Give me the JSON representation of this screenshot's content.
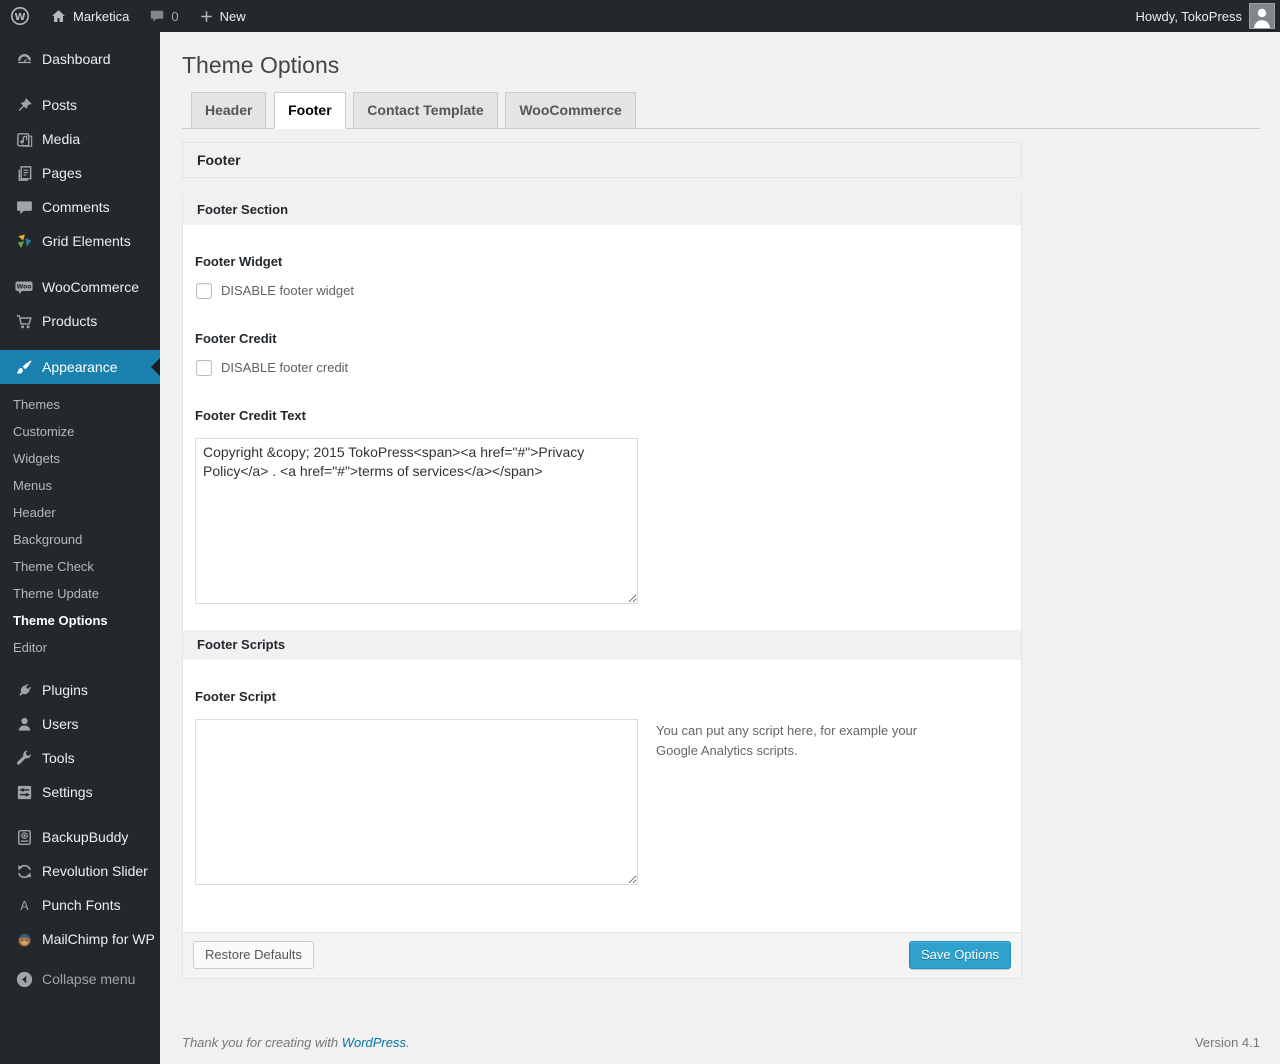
{
  "admin_bar": {
    "site_name": "Marketica",
    "comment_count": "0",
    "new_label": "New",
    "howdy": "Howdy, TokoPress"
  },
  "sidebar": {
    "items": [
      {
        "label": "Dashboard"
      },
      {
        "label": "Posts"
      },
      {
        "label": "Media"
      },
      {
        "label": "Pages"
      },
      {
        "label": "Comments"
      },
      {
        "label": "Grid Elements"
      },
      {
        "label": "WooCommerce"
      },
      {
        "label": "Products"
      },
      {
        "label": "Appearance"
      },
      {
        "label": "Plugins"
      },
      {
        "label": "Users"
      },
      {
        "label": "Tools"
      },
      {
        "label": "Settings"
      },
      {
        "label": "BackupBuddy"
      },
      {
        "label": "Revolution Slider"
      },
      {
        "label": "Punch Fonts"
      },
      {
        "label": "MailChimp for WP"
      },
      {
        "label": "Collapse menu"
      }
    ],
    "appearance_submenu": [
      "Themes",
      "Customize",
      "Widgets",
      "Menus",
      "Header",
      "Background",
      "Theme Check",
      "Theme Update",
      "Theme Options",
      "Editor"
    ],
    "current_item": "Appearance",
    "current_submenu_item": "Theme Options"
  },
  "page": {
    "title": "Theme Options"
  },
  "tabs": [
    {
      "label": "Header",
      "active": false
    },
    {
      "label": "Footer",
      "active": true
    },
    {
      "label": "Contact Template",
      "active": false
    },
    {
      "label": "WooCommerce",
      "active": false
    }
  ],
  "panel": {
    "heading": "Footer",
    "sections": [
      {
        "title": "Footer Section"
      },
      {
        "title": "Footer Scripts"
      }
    ],
    "fields": {
      "footer_widget": {
        "label": "Footer Widget",
        "checkbox_label": "DISABLE footer widget",
        "checked": false
      },
      "footer_credit": {
        "label": "Footer Credit",
        "checkbox_label": "DISABLE footer credit",
        "checked": false
      },
      "footer_credit_text": {
        "label": "Footer Credit Text",
        "value": "Copyright &copy; 2015 TokoPress<span><a href=\"#\">Privacy Policy</a> . <a href=\"#\">terms of services</a></span>"
      },
      "footer_script": {
        "label": "Footer Script",
        "value": "",
        "description": "You can put any script here, for example your Google Analytics scripts."
      }
    },
    "actions": {
      "restore": "Restore Defaults",
      "save": "Save Options"
    }
  },
  "footer": {
    "thanks_prefix": "Thank you for creating with",
    "wordpress_link": "WordPress",
    "suffix": ".",
    "version": "Version 4.1"
  },
  "icons": {
    "wordpress-logo": "W in circle",
    "home": "house",
    "comments-bubble": "speech bubble",
    "plus": "+",
    "grid-elements": "tri-color shards",
    "collapse": "left arrow in circle"
  },
  "colors": {
    "adminbar_bg": "#23282d",
    "menu_highlight": "#1b82af",
    "button_primary": "#2ea2cc",
    "link": "#0074a2",
    "page_bg": "#f1f1f1"
  }
}
